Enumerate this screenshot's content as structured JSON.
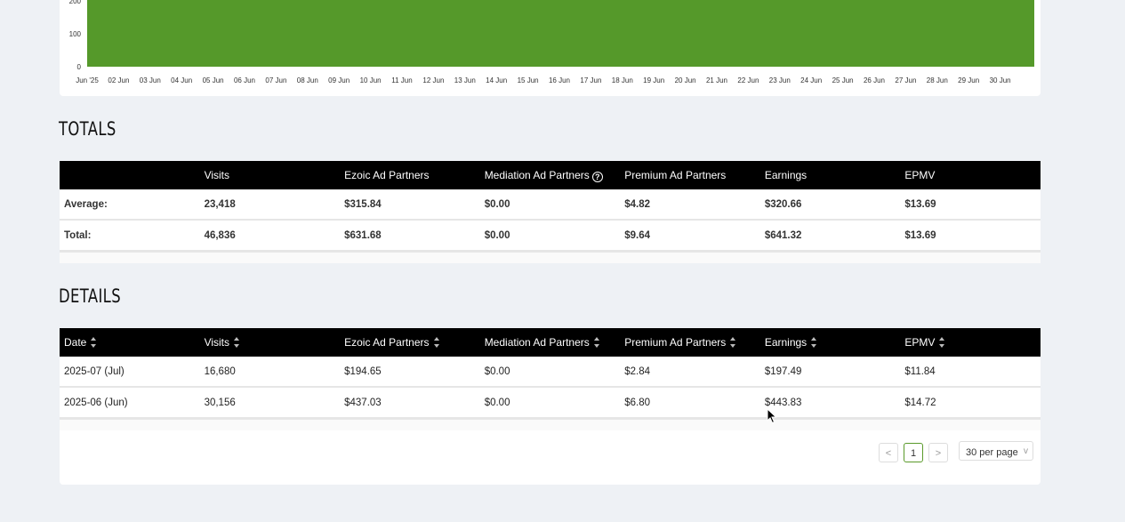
{
  "chart_data": {
    "type": "area",
    "color": "#55992a",
    "yticks": [
      "200",
      "100",
      "0"
    ],
    "ytick_values": [
      200,
      100,
      0
    ],
    "ylim": [
      0,
      220
    ],
    "xticks": [
      "Jun '25",
      "02 Jun",
      "03 Jun",
      "04 Jun",
      "05 Jun",
      "06 Jun",
      "07 Jun",
      "08 Jun",
      "09 Jun",
      "10 Jun",
      "11 Jun",
      "12 Jun",
      "13 Jun",
      "14 Jun",
      "15 Jun",
      "16 Jun",
      "17 Jun",
      "18 Jun",
      "19 Jun",
      "20 Jun",
      "21 Jun",
      "22 Jun",
      "23 Jun",
      "24 Jun",
      "25 Jun",
      "26 Jun",
      "27 Jun",
      "28 Jun",
      "29 Jun",
      "30 Jun"
    ],
    "series": [
      {
        "values": [
          220,
          220,
          220,
          220,
          220,
          220,
          220,
          220,
          220,
          220,
          220,
          220,
          220,
          220,
          220,
          220,
          220,
          220,
          220,
          220,
          220,
          220,
          220,
          220,
          220,
          220,
          220,
          220,
          218,
          212,
          205
        ]
      }
    ]
  },
  "totals": {
    "title": "TOTALS",
    "headers": [
      "",
      "Visits",
      "Ezoic Ad Partners",
      "Mediation Ad Partners",
      "Premium Ad Partners",
      "Earnings",
      "EPMV"
    ],
    "help_icon": "?",
    "rows": [
      [
        "Average:",
        "23,418",
        "$315.84",
        "$0.00",
        "$4.82",
        "$320.66",
        "$13.69"
      ],
      [
        "Total:",
        "46,836",
        "$631.68",
        "$0.00",
        "$9.64",
        "$641.32",
        "$13.69"
      ]
    ]
  },
  "details": {
    "title": "DETAILS",
    "headers": [
      "Date",
      "Visits",
      "Ezoic Ad Partners",
      "Mediation Ad Partners",
      "Premium Ad Partners",
      "Earnings",
      "EPMV"
    ],
    "rows": [
      [
        "2025-07 (Jul)",
        "16,680",
        "$194.65",
        "$0.00",
        "$2.84",
        "$197.49",
        "$11.84"
      ],
      [
        "2025-06 (Jun)",
        "30,156",
        "$437.03",
        "$0.00",
        "$6.80",
        "$443.83",
        "$14.72"
      ]
    ]
  },
  "pagination": {
    "prev": "<",
    "page": "1",
    "next": ">",
    "per_page": "30 per page",
    "chevron": "v"
  },
  "icons": {
    "sort": "sort-icon",
    "help": "help-circle-icon",
    "cursor": "mouse-cursor-icon"
  }
}
